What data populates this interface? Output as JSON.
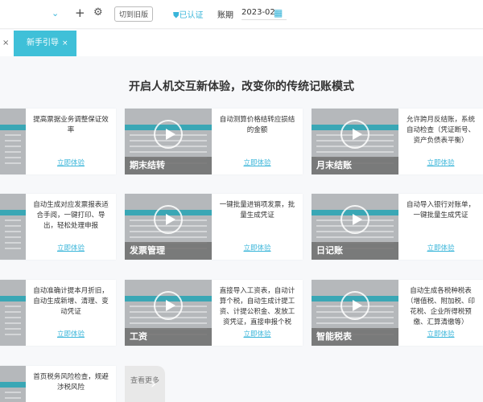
{
  "topbar": {
    "chevron_icon": "chevron-down-icon",
    "plus_icon": "plus-icon",
    "gear_icon": "gear-icon",
    "switch_old_version": "切到旧版",
    "verified": "已认证",
    "period_label": "账期",
    "period_value": "2023-02",
    "calendar_icon": "calendar-icon"
  },
  "tabs": [
    {
      "label": "新手引导",
      "close": "×",
      "active": true
    }
  ],
  "tabbar": {
    "close_left": "×"
  },
  "main": {
    "title": "开启人机交互新体验，改变你的传统记账模式",
    "cards": [
      {
        "thumb_label": "",
        "desc": "提高票据业务调整保证效率",
        "link": "立即体验"
      },
      {
        "thumb_label": "期末结转",
        "desc": "自动测算价格结转应损结的金额",
        "link": "立即体验"
      },
      {
        "thumb_label": "月末结账",
        "desc": "允许跨月反结账，系统自动检查（凭证断号、资产负债表平衡）",
        "link": "立即体验"
      },
      {
        "thumb_label": "",
        "desc": "自动生成对应发票报表适合手阅，一键打印、导出，轻松处理申报",
        "link": "立即体验"
      },
      {
        "thumb_label": "发票管理",
        "desc": "一键批量进销项发票，批量生成凭证",
        "link": "立即体验"
      },
      {
        "thumb_label": "日记账",
        "desc": "自动导入银行对账单，一键批量生成凭证",
        "link": "立即体验"
      },
      {
        "thumb_label": "",
        "desc": "自动准确计提本月折旧，自动生成新增、清理、变动凭证",
        "link": "立即体验"
      },
      {
        "thumb_label": "工资",
        "desc": "直接导入工资表，自动计算个税，自动生成计提工资、计提公积金、发放工资凭证，直接申报个税",
        "link": "立即体验"
      },
      {
        "thumb_label": "智能税表",
        "desc": "自动生成各税种税表（增值税、附加税、印花税、企业所得税预缴、汇算清缴等）",
        "link": "立即体验"
      },
      {
        "thumb_label": "",
        "desc": "首页税务风险检查，规避涉税风险",
        "link": ""
      }
    ],
    "more_label": "查看更多",
    "more_icon": "chevron-right-icon"
  },
  "colors": {
    "accent": "#3fc0d8",
    "link": "#39b5d9"
  }
}
